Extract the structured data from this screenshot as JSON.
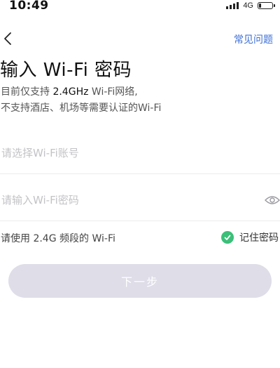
{
  "status_bar": {
    "time": "10:49",
    "network": "4G",
    "battery_fraction": 0.2
  },
  "nav": {
    "back_icon": "chevron-left-icon",
    "faq_label": "常见问题"
  },
  "title": "输入 Wi-Fi 密码",
  "description": {
    "line1_prefix": "目前仅支持 ",
    "line1_bold": "2.4GHz",
    "line1_suffix": " Wi-Fi网络,",
    "line2": "不支持酒店、机场等需要认证的Wi-Fi"
  },
  "form": {
    "ssid_placeholder": "请选择Wi-Fi账号",
    "password_placeholder": "请输入Wi-Fi密码",
    "eye_icon": "eye-icon"
  },
  "hint": "请使用 2.4G 频段的 Wi-Fi",
  "remember": {
    "label": "记住密码",
    "checked": true,
    "color": "#3cbf78"
  },
  "next_button": {
    "label": "下一步",
    "enabled": false
  },
  "colors": {
    "link": "#3d6fd6",
    "button_disabled": "#dedde8"
  }
}
